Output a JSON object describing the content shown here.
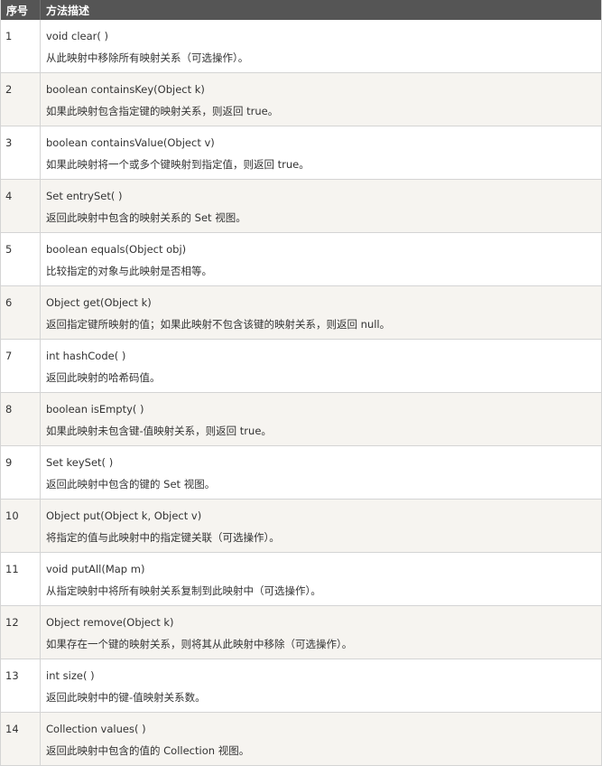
{
  "table": {
    "headers": [
      "序号",
      "方法描述"
    ],
    "rows": [
      {
        "index": "1",
        "signature": "void clear( )",
        "description": " 从此映射中移除所有映射关系（可选操作）。"
      },
      {
        "index": "2",
        "signature": "boolean containsKey(Object k)",
        "description": "如果此映射包含指定键的映射关系，则返回 true。"
      },
      {
        "index": "3",
        "signature": "boolean containsValue(Object v)",
        "description": "如果此映射将一个或多个键映射到指定值，则返回 true。"
      },
      {
        "index": "4",
        "signature": "Set entrySet( )",
        "description": "返回此映射中包含的映射关系的 Set 视图。"
      },
      {
        "index": "5",
        "signature": "boolean equals(Object obj)",
        "description": "比较指定的对象与此映射是否相等。"
      },
      {
        "index": "6",
        "signature": "Object get(Object k)",
        "description": "返回指定键所映射的值；如果此映射不包含该键的映射关系，则返回 null。"
      },
      {
        "index": "7",
        "signature": "int hashCode( )",
        "description": "返回此映射的哈希码值。"
      },
      {
        "index": "8",
        "signature": "boolean isEmpty( )",
        "description": "如果此映射未包含键-值映射关系，则返回 true。"
      },
      {
        "index": "9",
        "signature": "Set keySet( )",
        "description": "返回此映射中包含的键的 Set 视图。"
      },
      {
        "index": "10",
        "signature": "Object put(Object k, Object v)",
        "description": "将指定的值与此映射中的指定键关联（可选操作）。"
      },
      {
        "index": "11",
        "signature": "void putAll(Map m)",
        "description": "从指定映射中将所有映射关系复制到此映射中（可选操作）。"
      },
      {
        "index": "12",
        "signature": "Object remove(Object k)",
        "description": "如果存在一个键的映射关系，则将其从此映射中移除（可选操作）。"
      },
      {
        "index": "13",
        "signature": "int size( )",
        "description": "返回此映射中的键-值映射关系数。"
      },
      {
        "index": "14",
        "signature": "Collection values( )",
        "description": "返回此映射中包含的值的 Collection 视图。"
      }
    ]
  }
}
